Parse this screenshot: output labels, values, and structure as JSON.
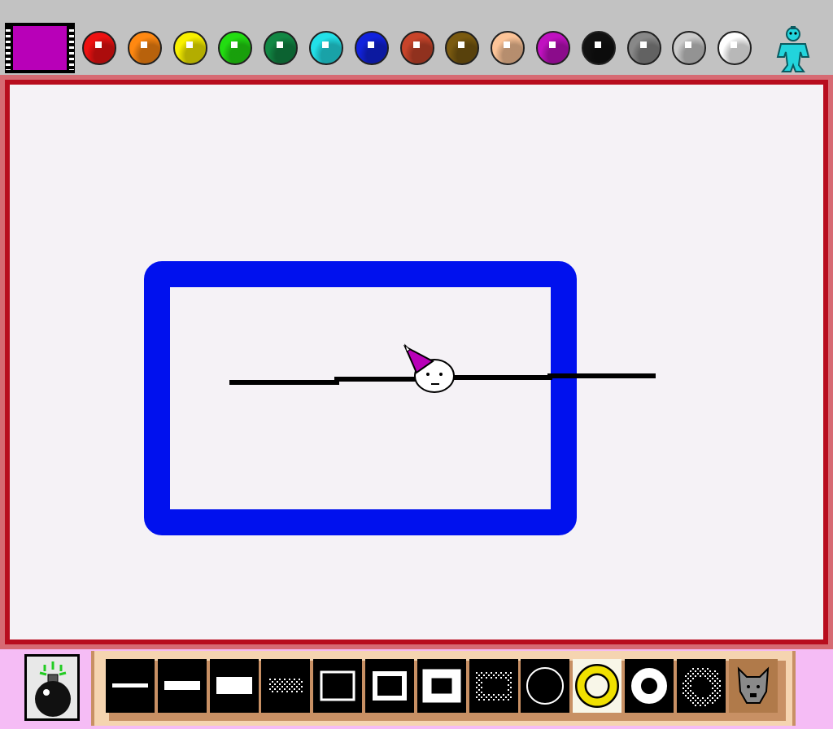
{
  "current_color": "#b800b8",
  "palette": {
    "colors": [
      {
        "name": "red",
        "hex": "#ee1111"
      },
      {
        "name": "orange",
        "hex": "#ff8811"
      },
      {
        "name": "yellow",
        "hex": "#f8f000"
      },
      {
        "name": "green",
        "hex": "#22dd11"
      },
      {
        "name": "dark-green",
        "hex": "#118844"
      },
      {
        "name": "cyan",
        "hex": "#22e0e8"
      },
      {
        "name": "blue",
        "hex": "#1122dd"
      },
      {
        "name": "rust",
        "hex": "#c8442a"
      },
      {
        "name": "brown",
        "hex": "#7a5a10"
      },
      {
        "name": "peach",
        "hex": "#fcc498"
      },
      {
        "name": "magenta",
        "hex": "#c011c0"
      },
      {
        "name": "black",
        "hex": "#111111"
      },
      {
        "name": "gray",
        "hex": "#888888"
      },
      {
        "name": "light-gray",
        "hex": "#cccccc"
      },
      {
        "name": "white",
        "hex": "#ffffff"
      }
    ],
    "stamp_icon": "cyan-robot-icon"
  },
  "canvas": {
    "background": "#f5f2f6",
    "border_color": "#b80d1e",
    "strokes": [
      {
        "shape": "rectangle-outline",
        "color": "#0011ee"
      },
      {
        "shape": "line",
        "color": "#000000"
      }
    ],
    "cursor_icon": "party-hat-ghost-cursor-icon"
  },
  "toolbar": {
    "eraser_icon": "bomb-icon",
    "brushes": [
      {
        "name": "thin-line"
      },
      {
        "name": "medium-line"
      },
      {
        "name": "thick-line"
      },
      {
        "name": "spray-line"
      },
      {
        "name": "thin-square"
      },
      {
        "name": "medium-square"
      },
      {
        "name": "thick-square"
      },
      {
        "name": "spray-square"
      },
      {
        "name": "thin-circle"
      },
      {
        "name": "thick-circle",
        "selected": true
      },
      {
        "name": "ring"
      },
      {
        "name": "spray-circle"
      },
      {
        "name": "dog-stamp"
      }
    ]
  }
}
